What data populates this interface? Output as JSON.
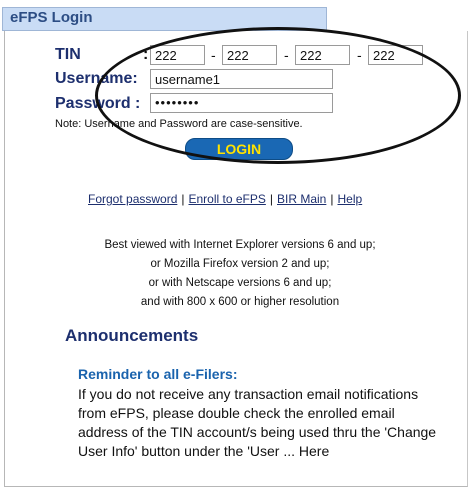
{
  "header": {
    "title": "eFPS Login"
  },
  "form": {
    "tin_label": "TIN",
    "tin_values": [
      "222",
      "222",
      "222",
      "222"
    ],
    "tin_separator": "-",
    "username_label": "Username:",
    "username_value": "username1",
    "password_label": "Password :",
    "password_mask": "••••••••",
    "colon": ":",
    "note": "Note: Username and Password are case-sensitive.",
    "login_button": "LOGIN"
  },
  "links": {
    "forgot": "Forgot password",
    "enroll": "Enroll to eFPS",
    "bir_main": "BIR Main",
    "help": "Help",
    "sep": "|"
  },
  "info_lines": [
    "Best viewed with Internet Explorer versions 6 and up;",
    "or Mozilla Firefox version 2 and up;",
    "or with Netscape versions 6 and up;",
    "and with 800 x 600 or higher resolution"
  ],
  "announcements": {
    "heading": "Announcements",
    "reminder_title": "Reminder to all e-Filers:",
    "reminder_body": "If you do not receive any transaction email notifications from eFPS, please double check the enrolled email address of the TIN account/s being used thru the 'Change User Info' button under the 'User ... Here"
  },
  "colors": {
    "header_bg": "#c9dcf5",
    "label": "#1d2f6e",
    "button_bg": "#1a68b4",
    "button_text": "#ffe200",
    "reminder": "#1a63ad"
  }
}
